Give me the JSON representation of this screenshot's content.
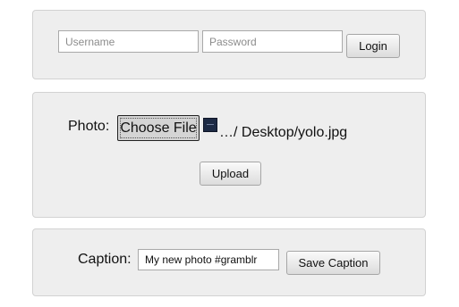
{
  "login": {
    "username_placeholder": "Username",
    "password_placeholder": "Password",
    "login_label": "Login"
  },
  "upload": {
    "photo_label": "Photo:",
    "choose_file_label": "Choose File",
    "file_path": "…/ Desktop/yolo.jpg",
    "file_icon": "image-thumbnail-icon",
    "upload_label": "Upload"
  },
  "caption": {
    "caption_label": "Caption:",
    "caption_value": "My new photo #gramblr",
    "save_label": "Save Caption"
  },
  "colors": {
    "panel_background": "#eeeeee",
    "panel_border": "#d2d2d2",
    "thumbnail": "#1d2a44"
  }
}
